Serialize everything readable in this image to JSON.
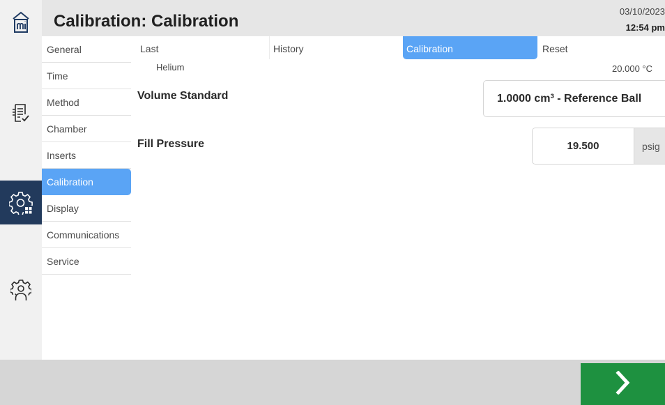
{
  "header": {
    "title": "Calibration: Calibration",
    "date": "03/10/2023",
    "time": "12:54 pm"
  },
  "nav_rail": {
    "items": [
      {
        "icon": "home-icon",
        "active": false
      },
      {
        "icon": "reports-icon",
        "active": false
      },
      {
        "icon": "instrument-settings-icon",
        "active": true
      },
      {
        "icon": "user-settings-icon",
        "active": false
      }
    ]
  },
  "settings_menu": {
    "items": [
      {
        "label": "General"
      },
      {
        "label": "Time"
      },
      {
        "label": "Method"
      },
      {
        "label": "Chamber"
      },
      {
        "label": "Inserts"
      },
      {
        "label": "Calibration",
        "active": true
      },
      {
        "label": "Display"
      },
      {
        "label": "Communications"
      },
      {
        "label": "Service"
      }
    ]
  },
  "tabs": [
    {
      "label": "Last"
    },
    {
      "label": "History"
    },
    {
      "label": "Calibration",
      "active": true
    },
    {
      "label": "Reset"
    }
  ],
  "status": {
    "gas": "Helium",
    "temperature": "20.000 °C"
  },
  "form": {
    "volume_standard": {
      "label": "Volume Standard",
      "value": "1.0000 cm³ - Reference Ball"
    },
    "fill_pressure": {
      "label": "Fill Pressure",
      "value": "19.500",
      "unit": "psig"
    }
  },
  "footer": {
    "next_icon": "chevron-right-icon"
  },
  "colors": {
    "accent_blue": "#5aa4f5",
    "rail_active": "#223a5c",
    "next_green": "#1e9140"
  }
}
